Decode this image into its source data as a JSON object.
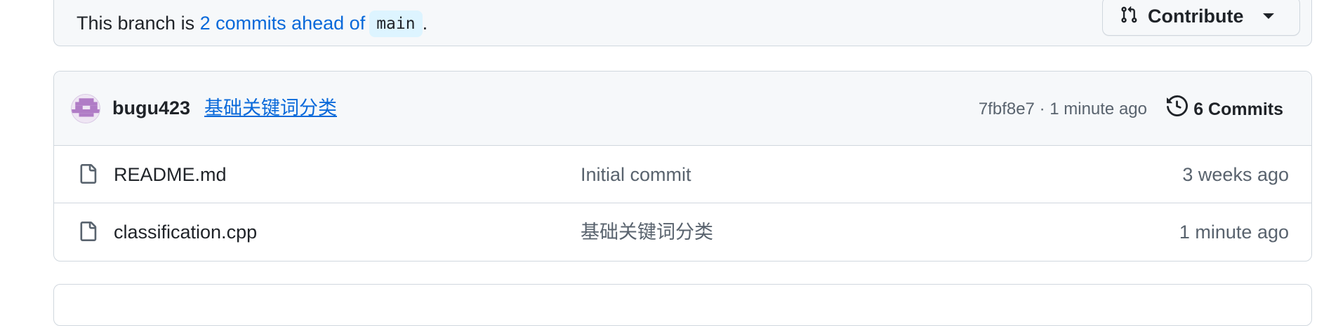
{
  "branch_status": {
    "prefix": "This branch is ",
    "ahead_link": "2 commits ahead of",
    "base_branch": "main",
    "suffix": "."
  },
  "contribute_button": {
    "label": "Contribute",
    "icon": "git-pull-request-icon"
  },
  "latest_commit": {
    "author": "bugu423",
    "message": "基础关键词分类",
    "meta": "7fbf8e7 · 1 minute ago",
    "commits_label": "6 Commits",
    "history_icon": "history-icon"
  },
  "files": [
    {
      "name": "README.md",
      "commit_message": "Initial commit",
      "date": "3 weeks ago",
      "icon": "file-icon"
    },
    {
      "name": "classification.cpp",
      "commit_message": "基础关键词分类",
      "date": "1 minute ago",
      "icon": "file-icon"
    }
  ],
  "colors": {
    "link": "#0969da",
    "muted": "#59636e",
    "border": "#d0d7de",
    "header_bg": "#f6f8fa"
  }
}
